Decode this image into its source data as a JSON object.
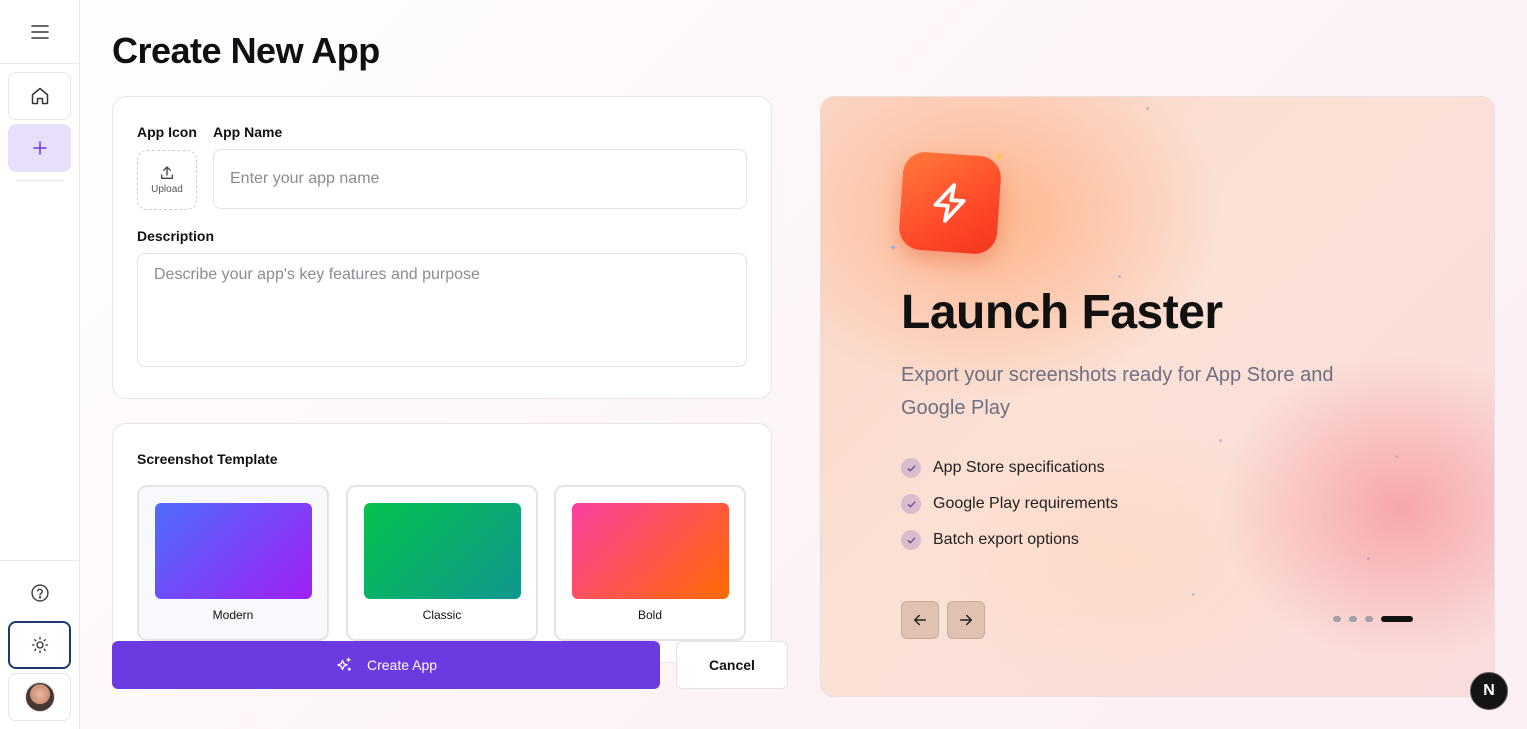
{
  "sidebar": {
    "icons": {
      "menu": "menu-icon",
      "home": "home-icon",
      "add": "plus-icon",
      "help": "help-circle-icon",
      "theme": "sun-icon",
      "avatar": "user-avatar"
    }
  },
  "page": {
    "title": "Create New App"
  },
  "form": {
    "app_icon_label": "App Icon",
    "upload_label": "Upload",
    "app_name_label": "App Name",
    "app_name_placeholder": "Enter your app name",
    "app_name_value": "",
    "description_label": "Description",
    "description_placeholder": "Describe your app's key features and purpose",
    "description_value": ""
  },
  "templates": {
    "label": "Screenshot Template",
    "options": [
      {
        "name": "Modern",
        "gradient": [
          "#4f6dfb",
          "#a020f5"
        ],
        "selected": true
      },
      {
        "name": "Classic",
        "gradient": [
          "#05c24e",
          "#10978e"
        ],
        "selected": false
      },
      {
        "name": "Bold",
        "gradient": [
          "#fb3ea0",
          "#ff6a00"
        ],
        "selected": false
      }
    ]
  },
  "actions": {
    "create_label": "Create App",
    "cancel_label": "Cancel"
  },
  "promo": {
    "title": "Launch Faster",
    "subtitle": "Export your screenshots ready for App Store and Google Play",
    "features": [
      "App Store specifications",
      "Google Play requirements",
      "Batch export options"
    ],
    "slide_count": 4,
    "active_slide": 4
  },
  "dev_badge": {
    "letter": "N"
  },
  "colors": {
    "accent": "#6b3ae0",
    "accent_soft": "#e8e0fb",
    "app_icon": "#ff5a2e"
  }
}
